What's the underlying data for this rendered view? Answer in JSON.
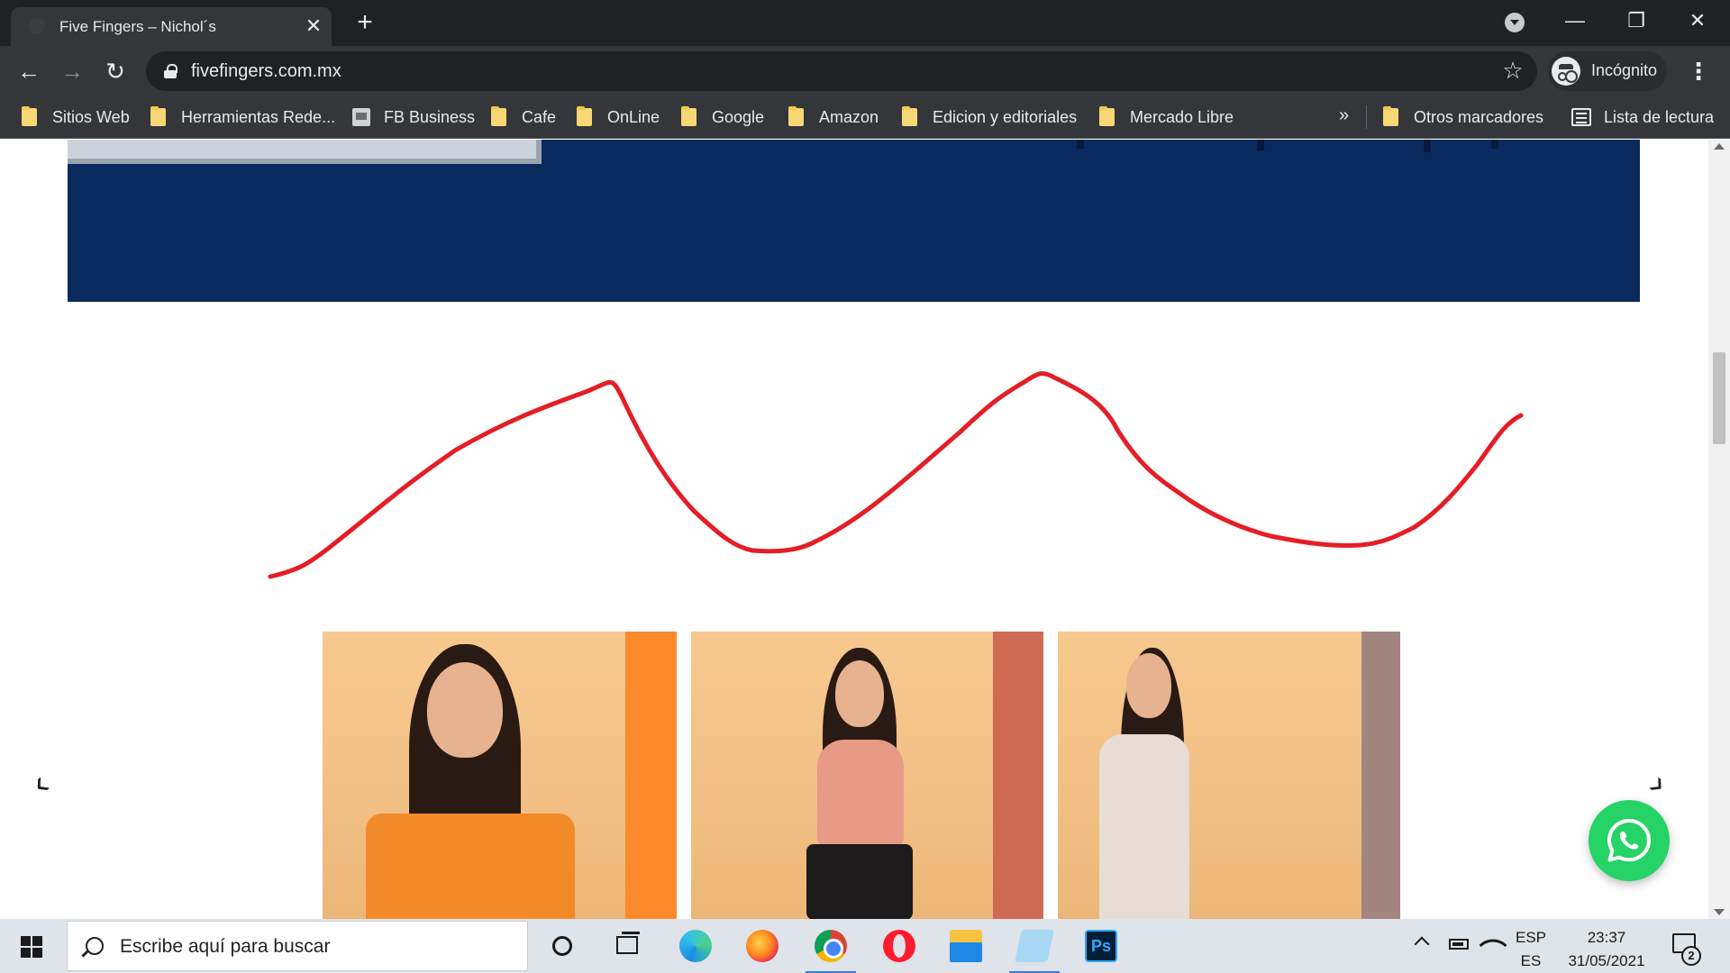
{
  "browser": {
    "tab": {
      "title": "Five Fingers – Nichol´s",
      "close": "✕"
    },
    "new_tab": "+",
    "window_controls": {
      "minimize": "—",
      "maximize": "❐",
      "close": "✕"
    },
    "nav": {
      "back": "←",
      "forward": "→",
      "reload": "↻"
    },
    "address": {
      "url": "fivefingers.com.mx",
      "star": "☆"
    },
    "profile": {
      "label": "Incógnito",
      "icon": "incognito-icon"
    },
    "menu": "⋮",
    "bookmarks": [
      {
        "label": "Sitios Web",
        "icon": "folder-icon"
      },
      {
        "label": "Herramientas Rede...",
        "icon": "folder-icon"
      },
      {
        "label": "FB Business",
        "icon": "page-icon"
      },
      {
        "label": "Cafe",
        "icon": "folder-icon"
      },
      {
        "label": "OnLine",
        "icon": "folder-icon"
      },
      {
        "label": "Google",
        "icon": "folder-icon"
      },
      {
        "label": "Amazon",
        "icon": "folder-icon"
      },
      {
        "label": "Edicion y editoriales",
        "icon": "folder-icon"
      },
      {
        "label": "Mercado Libre",
        "icon": "folder-icon"
      }
    ],
    "bookmarks_more": "»",
    "other_bookmarks": "Otros marcadores",
    "reading_list": "Lista de lectura"
  },
  "page": {
    "hero_color": "#0a2a5e",
    "doodle_color": "#e41e26",
    "products": [
      {
        "name": "orange striped tee",
        "stripe_color": "#fb8a2c",
        "top_color": "#f28a2a"
      },
      {
        "name": "coral striped tank",
        "stripe_color": "#cf6a55",
        "top_color": "#e79a86"
      },
      {
        "name": "striped jumpsuit",
        "stripe_color": "#a38580",
        "top_color": "#e5ddd6"
      }
    ],
    "carousel": {
      "prev": "‹",
      "next": "›"
    },
    "whatsapp_icon": "whatsapp-icon",
    "whatsapp_color": "#25d366"
  },
  "taskbar": {
    "search_placeholder": "Escribe aquí para buscar",
    "apps": [
      "cortana-icon",
      "task-view-icon",
      "edge-icon",
      "firefox-icon",
      "chrome-icon",
      "opera-icon",
      "file-explorer-icon",
      "notes-icon",
      "photoshop-icon"
    ],
    "photoshop_label": "Ps",
    "language": {
      "line1": "ESP",
      "line2": "ES"
    },
    "clock": {
      "time": "23:37",
      "date": "31/05/2021"
    },
    "notifications": "2"
  }
}
